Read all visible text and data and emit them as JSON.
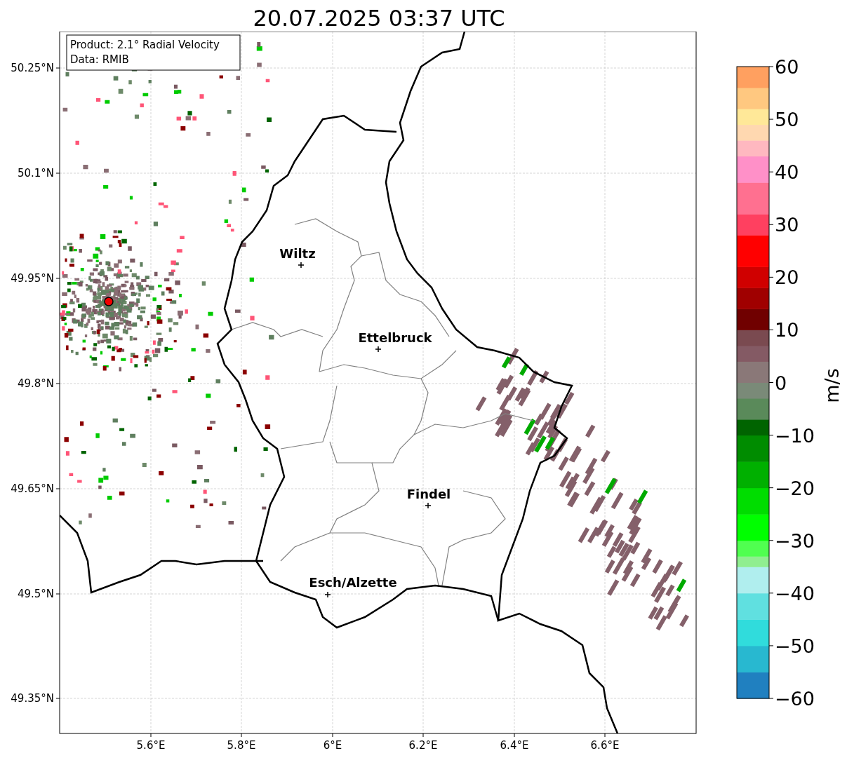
{
  "title": "20.07.2025 03:37 UTC",
  "legend": {
    "lines": [
      "Product: 2.1° Radial Velocity",
      "Data: RMIB"
    ]
  },
  "map": {
    "x_ticks": [
      "5.6°E",
      "5.8°E",
      "6°E",
      "6.2°E",
      "6.4°E",
      "6.6°E"
    ],
    "y_ticks": [
      "50.25°N",
      "50.1°N",
      "49.95°N",
      "49.8°N",
      "49.65°N",
      "49.5°N",
      "49.35°N"
    ],
    "places": [
      {
        "name": "Wiltz"
      },
      {
        "name": "Ettelbruck"
      },
      {
        "name": "Findel"
      },
      {
        "name": "Esch/Alzette"
      }
    ]
  },
  "colorbar": {
    "label": "m/s",
    "ticks": [
      "60",
      "50",
      "40",
      "30",
      "20",
      "10",
      "0",
      "−10",
      "−20",
      "−30",
      "−40",
      "−50",
      "−60"
    ]
  }
}
